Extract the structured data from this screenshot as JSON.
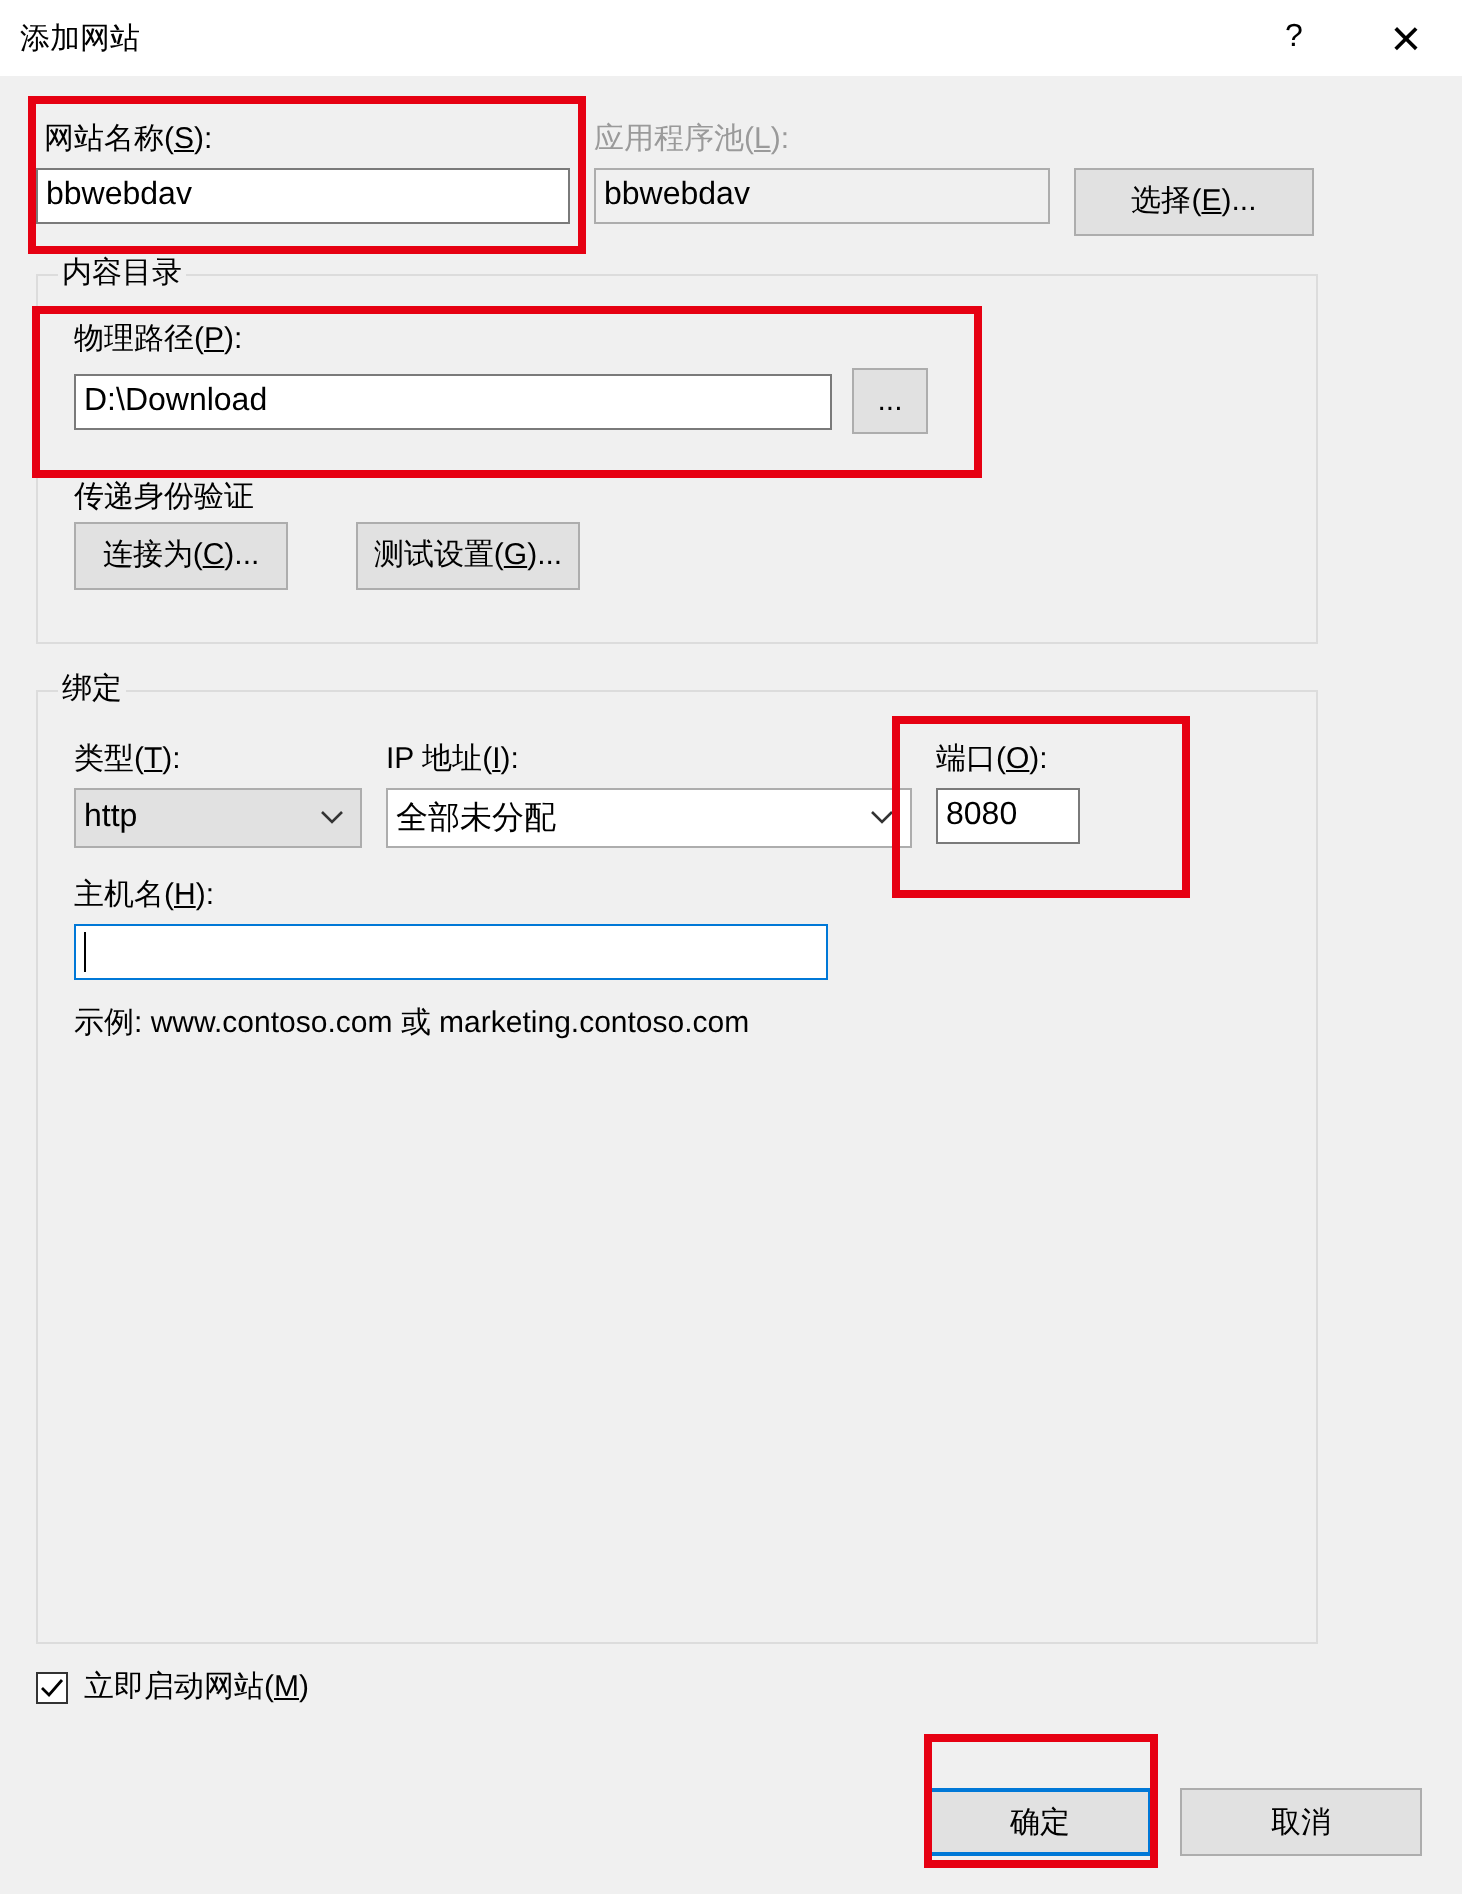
{
  "window": {
    "title": "添加网站",
    "help": "?",
    "close": "×"
  },
  "site_name": {
    "label": {
      "text": "网站名称(",
      "key": "S",
      "end": "):"
    },
    "value": "bbwebdav"
  },
  "app_pool": {
    "label": {
      "text": "应用程序池(",
      "key": "L",
      "end": "):"
    },
    "value": "bbwebdav",
    "disabled": true,
    "button": {
      "text": "选择(",
      "key": "E",
      "end": ")..."
    }
  },
  "content_directory": {
    "legend": "内容目录",
    "path_label": {
      "text": "物理路径(",
      "key": "P",
      "end": "):"
    },
    "path": "D:\\Download",
    "browse": "...",
    "auth_label": "传递身份验证",
    "buttons": [
      {
        "text": "连接为(",
        "key": "C",
        "end": ")..."
      },
      {
        "text": "测试设置(",
        "key": "G",
        "end": ")..."
      }
    ]
  },
  "binding": {
    "legend": "绑定",
    "type_label": {
      "text": "类型(",
      "key": "T",
      "end": "):"
    },
    "type": "http",
    "ip_label": {
      "text": "IP 地址(",
      "key": "I",
      "end": "):"
    },
    "ip": "全部未分配",
    "port_label": {
      "text": "端口(",
      "key": "O",
      "end": "):"
    },
    "port": "8080",
    "host_label": {
      "text": "主机名(",
      "key": "H",
      "end": "):"
    },
    "example": "示例: www.contoso.com 或 marketing.contoso.com"
  },
  "start_now": {
    "label": {
      "text": "立即启动网站(",
      "key": "M",
      "end": ")"
    },
    "checked": true
  },
  "buttons": [
    {
      "label": "确定",
      "default": true
    },
    {
      "label": "取消",
      "default": false
    }
  ]
}
